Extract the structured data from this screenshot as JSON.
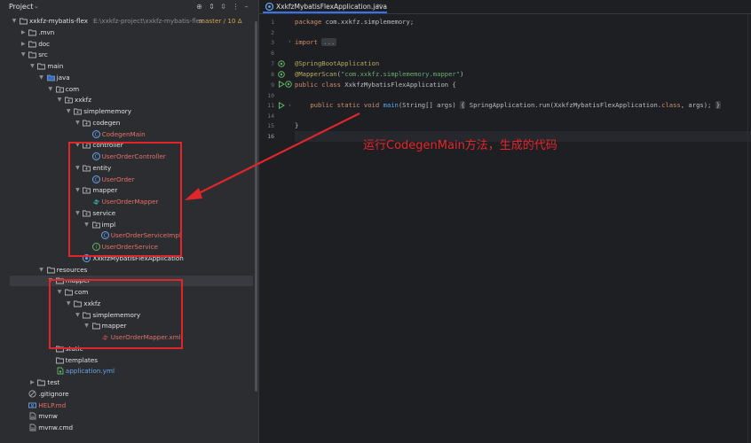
{
  "project_panel": {
    "title": "Project",
    "tree": [
      {
        "depth": 0,
        "expanded": true,
        "icon": "module-folder-icon",
        "label": "xxkfz-mybatis-flex",
        "path": "E:\\xxkfz-project\\xxkfz-mybatis-flex",
        "branch": "master / 10 Δ",
        "kind": "root"
      },
      {
        "depth": 1,
        "expanded": false,
        "icon": "folder-icon",
        "label": ".mvn",
        "kind": "folder"
      },
      {
        "depth": 1,
        "expanded": false,
        "icon": "folder-icon",
        "label": "doc",
        "kind": "folder"
      },
      {
        "depth": 1,
        "expanded": true,
        "icon": "folder-icon",
        "label": "src",
        "kind": "folder"
      },
      {
        "depth": 2,
        "expanded": true,
        "icon": "folder-icon",
        "label": "main",
        "kind": "folder"
      },
      {
        "depth": 3,
        "expanded": true,
        "icon": "source-folder-icon",
        "label": "java",
        "kind": "folder"
      },
      {
        "depth": 4,
        "expanded": true,
        "icon": "package-icon",
        "label": "com",
        "kind": "folder"
      },
      {
        "depth": 5,
        "expanded": true,
        "icon": "package-icon",
        "label": "xxkfz",
        "kind": "folder"
      },
      {
        "depth": 6,
        "expanded": true,
        "icon": "package-icon",
        "label": "simplememory",
        "kind": "folder"
      },
      {
        "depth": 7,
        "expanded": true,
        "icon": "package-icon",
        "label": "codegen",
        "kind": "folder"
      },
      {
        "depth": 8,
        "expanded": null,
        "icon": "class-icon",
        "label": "CodegenMain",
        "kind": "java-red"
      },
      {
        "depth": 7,
        "expanded": true,
        "icon": "package-icon",
        "label": "controller",
        "kind": "folder"
      },
      {
        "depth": 8,
        "expanded": null,
        "icon": "class-icon",
        "label": "UserOrderController",
        "kind": "java-red"
      },
      {
        "depth": 7,
        "expanded": true,
        "icon": "package-icon",
        "label": "entity",
        "kind": "folder"
      },
      {
        "depth": 8,
        "expanded": null,
        "icon": "class-icon",
        "label": "UserOrder",
        "kind": "java-red"
      },
      {
        "depth": 7,
        "expanded": true,
        "icon": "package-icon",
        "label": "mapper",
        "kind": "folder"
      },
      {
        "depth": 8,
        "expanded": null,
        "icon": "mapper-interface-icon",
        "label": "UserOrderMapper",
        "kind": "java-red"
      },
      {
        "depth": 7,
        "expanded": true,
        "icon": "package-icon",
        "label": "service",
        "kind": "folder"
      },
      {
        "depth": 8,
        "expanded": true,
        "icon": "package-icon",
        "label": "impl",
        "kind": "folder"
      },
      {
        "depth": 9,
        "expanded": null,
        "icon": "class-icon",
        "label": "UserOrderServiceImpl",
        "kind": "java-red"
      },
      {
        "depth": 8,
        "expanded": null,
        "icon": "interface-icon",
        "label": "UserOrderService",
        "kind": "java-red"
      },
      {
        "depth": 7,
        "expanded": null,
        "icon": "spring-class-icon",
        "label": "XxkfzMybatisFlexApplication",
        "kind": "file"
      },
      {
        "depth": 3,
        "expanded": true,
        "icon": "resources-folder-icon",
        "label": "resources",
        "kind": "folder"
      },
      {
        "depth": 4,
        "expanded": true,
        "icon": "folder-icon",
        "label": "mapper",
        "kind": "folder",
        "selected": true
      },
      {
        "depth": 5,
        "expanded": true,
        "icon": "folder-icon",
        "label": "com",
        "kind": "folder"
      },
      {
        "depth": 6,
        "expanded": true,
        "icon": "folder-icon",
        "label": "xxkfz",
        "kind": "folder"
      },
      {
        "depth": 7,
        "expanded": true,
        "icon": "folder-icon",
        "label": "simplememory",
        "kind": "folder"
      },
      {
        "depth": 8,
        "expanded": true,
        "icon": "folder-icon",
        "label": "mapper",
        "kind": "folder"
      },
      {
        "depth": 9,
        "expanded": null,
        "icon": "xml-icon",
        "label": "UserOrderMapper.xml",
        "kind": "java-red"
      },
      {
        "depth": 4,
        "expanded": null,
        "icon": "folder-icon",
        "label": "static",
        "kind": "folder"
      },
      {
        "depth": 4,
        "expanded": null,
        "icon": "folder-icon",
        "label": "templates",
        "kind": "folder"
      },
      {
        "depth": 4,
        "expanded": null,
        "icon": "yml-icon",
        "label": "application.yml",
        "kind": "yml"
      },
      {
        "depth": 2,
        "expanded": false,
        "icon": "folder-icon",
        "label": "test",
        "kind": "folder"
      },
      {
        "depth": 1,
        "expanded": null,
        "icon": "gitignore-icon",
        "label": ".gitignore",
        "kind": "file"
      },
      {
        "depth": 1,
        "expanded": null,
        "icon": "markdown-icon",
        "label": "HELP.md",
        "kind": "md"
      },
      {
        "depth": 1,
        "expanded": null,
        "icon": "file-icon",
        "label": "mvnw",
        "kind": "file"
      },
      {
        "depth": 1,
        "expanded": null,
        "icon": "file-icon",
        "label": "mvnw.cmd",
        "kind": "file"
      }
    ]
  },
  "editor": {
    "tab_label": "XxkfzMybatisFlexApplication.java",
    "lines": [
      {
        "n": "1",
        "segments": [
          [
            "kw",
            "package "
          ],
          [
            "",
            "com.xxkfz.simplememory;"
          ]
        ]
      },
      {
        "n": "2",
        "segments": []
      },
      {
        "n": "3",
        "segments": [
          [
            "kw",
            "import "
          ],
          [
            "fold",
            "..."
          ]
        ]
      },
      {
        "n": "6",
        "segments": []
      },
      {
        "n": "7",
        "segments": [
          [
            "ann",
            "@SpringBootApplication"
          ]
        ]
      },
      {
        "n": "8",
        "segments": [
          [
            "ann",
            "@MapperScan"
          ],
          [
            "",
            "("
          ],
          [
            "str",
            "\"com.xxkfz.simplememory.mapper\""
          ],
          [
            "",
            ")"
          ]
        ]
      },
      {
        "n": "9",
        "segments": [
          [
            "kw",
            "public class "
          ],
          [
            "",
            "XxkfzMybatisFlexApplication {"
          ]
        ]
      },
      {
        "n": "10",
        "segments": []
      },
      {
        "n": "11",
        "segments": [
          [
            "",
            "    "
          ],
          [
            "kw",
            "public static void "
          ],
          [
            "fn",
            "main"
          ],
          [
            "",
            "(String[] args) "
          ],
          [
            "brace",
            "{"
          ],
          [
            "",
            " SpringApplication."
          ],
          [
            "",
            "run(XxkfzMybatisFlexApplication."
          ],
          [
            "kw",
            "class"
          ],
          [
            "",
            ", args); "
          ],
          [
            "brace",
            "}"
          ]
        ]
      },
      {
        "n": "14",
        "segments": []
      },
      {
        "n": "15",
        "segments": [
          [
            "",
            "}"
          ]
        ]
      },
      {
        "n": "16",
        "segments": []
      }
    ]
  },
  "annotation": {
    "text": "运行CodegenMain方法，生成的代码",
    "color": "#e0262b"
  }
}
